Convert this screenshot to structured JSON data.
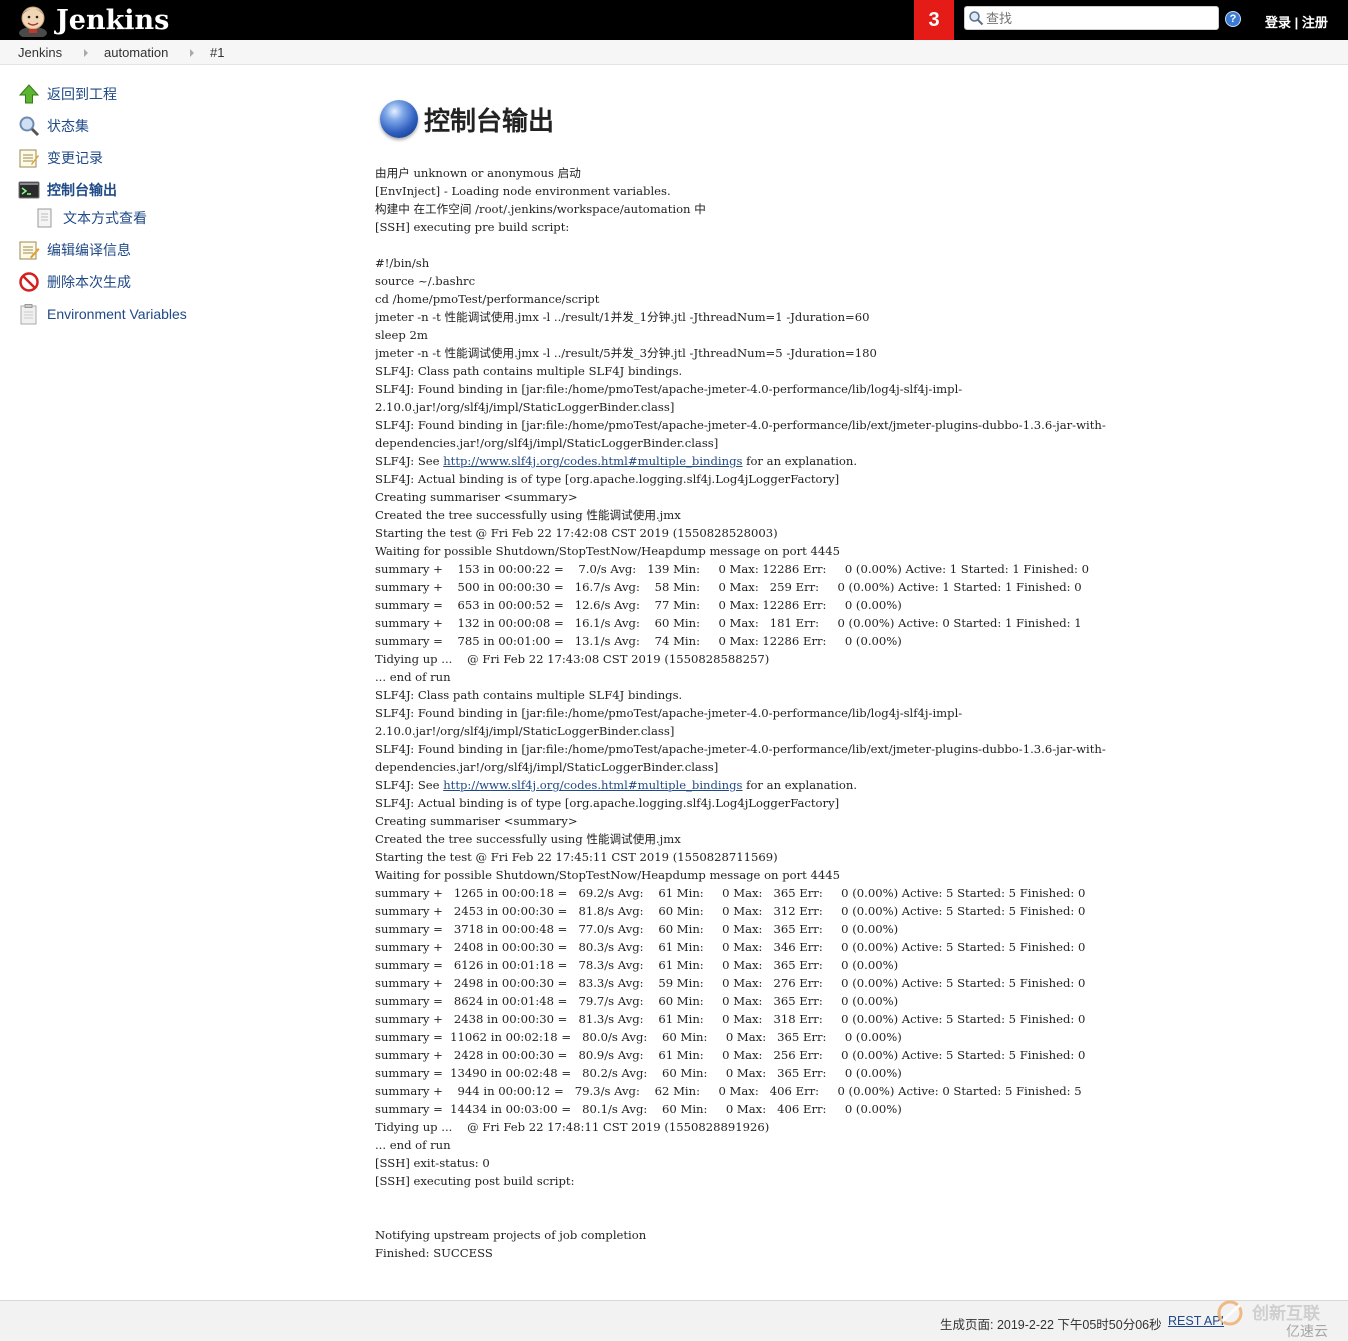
{
  "header": {
    "title": "Jenkins",
    "notification_count": "3",
    "search_placeholder": "查找",
    "help": "?",
    "login": "登录",
    "separator": "|",
    "signup": "注册"
  },
  "breadcrumb": [
    "Jenkins",
    "automation",
    "#1"
  ],
  "sidebar": {
    "items": [
      {
        "label": "返回到工程",
        "icon": "up-arrow-icon"
      },
      {
        "label": "状态集",
        "icon": "magnifier-icon"
      },
      {
        "label": "变更记录",
        "icon": "notepad-icon"
      },
      {
        "label": "控制台输出",
        "icon": "terminal-icon"
      },
      {
        "label": "文本方式查看",
        "icon": "document-icon"
      },
      {
        "label": "编辑编译信息",
        "icon": "notepad-edit-icon"
      },
      {
        "label": "删除本次生成",
        "icon": "no-entry-icon"
      },
      {
        "label": "Environment Variables",
        "icon": "clipboard-icon"
      }
    ]
  },
  "main": {
    "title": "控制台输出",
    "console_lines": [
      "由用户 unknown or anonymous 启动",
      "[EnvInject] - Loading node environment variables.",
      "构建中 在工作空间 /root/.jenkins/workspace/automation 中",
      "[SSH] executing pre build script:",
      "",
      "#!/bin/sh",
      "source ~/.bashrc",
      "cd /home/pmoTest/performance/script",
      "jmeter -n -t 性能调试使用.jmx -l ../result/1并发_1分钟.jtl -JthreadNum=1 -Jduration=60",
      "sleep 2m",
      "jmeter -n -t 性能调试使用.jmx -l ../result/5并发_3分钟.jtl -JthreadNum=5 -Jduration=180",
      "SLF4J: Class path contains multiple SLF4J bindings.",
      "SLF4J: Found binding in [jar:file:/home/pmoTest/apache-jmeter-4.0-performance/lib/log4j-slf4j-impl-",
      "2.10.0.jar!/org/slf4j/impl/StaticLoggerBinder.class]",
      "SLF4J: Found binding in [jar:file:/home/pmoTest/apache-jmeter-4.0-performance/lib/ext/jmeter-plugins-dubbo-1.3.6-jar-with-",
      "dependencies.jar!/org/slf4j/impl/StaticLoggerBinder.class]",
      "SLF4J: See http://www.slf4j.org/codes.html#multiple_bindings for an explanation.",
      "SLF4J: Actual binding is of type [org.apache.logging.slf4j.Log4jLoggerFactory]",
      "Creating summariser <summary>",
      "Created the tree successfully using 性能调试使用.jmx",
      "Starting the test @ Fri Feb 22 17:42:08 CST 2019 (1550828528003)",
      "Waiting for possible Shutdown/StopTestNow/Heapdump message on port 4445",
      "summary +    153 in 00:00:22 =    7.0/s Avg:   139 Min:     0 Max: 12286 Err:     0 (0.00%) Active: 1 Started: 1 Finished: 0",
      "summary +    500 in 00:00:30 =   16.7/s Avg:    58 Min:     0 Max:   259 Err:     0 (0.00%) Active: 1 Started: 1 Finished: 0",
      "summary =    653 in 00:00:52 =   12.6/s Avg:    77 Min:     0 Max: 12286 Err:     0 (0.00%)",
      "summary +    132 in 00:00:08 =   16.1/s Avg:    60 Min:     0 Max:   181 Err:     0 (0.00%) Active: 0 Started: 1 Finished: 1",
      "summary =    785 in 00:01:00 =   13.1/s Avg:    74 Min:     0 Max: 12286 Err:     0 (0.00%)",
      "Tidying up ...    @ Fri Feb 22 17:43:08 CST 2019 (1550828588257)",
      "... end of run",
      "SLF4J: Class path contains multiple SLF4J bindings.",
      "SLF4J: Found binding in [jar:file:/home/pmoTest/apache-jmeter-4.0-performance/lib/log4j-slf4j-impl-",
      "2.10.0.jar!/org/slf4j/impl/StaticLoggerBinder.class]",
      "SLF4J: Found binding in [jar:file:/home/pmoTest/apache-jmeter-4.0-performance/lib/ext/jmeter-plugins-dubbo-1.3.6-jar-with-",
      "dependencies.jar!/org/slf4j/impl/StaticLoggerBinder.class]",
      "SLF4J: See http://www.slf4j.org/codes.html#multiple_bindings for an explanation.",
      "SLF4J: Actual binding is of type [org.apache.logging.slf4j.Log4jLoggerFactory]",
      "Creating summariser <summary>",
      "Created the tree successfully using 性能调试使用.jmx",
      "Starting the test @ Fri Feb 22 17:45:11 CST 2019 (1550828711569)",
      "Waiting for possible Shutdown/StopTestNow/Heapdump message on port 4445",
      "summary +   1265 in 00:00:18 =   69.2/s Avg:    61 Min:     0 Max:   365 Err:     0 (0.00%) Active: 5 Started: 5 Finished: 0",
      "summary +   2453 in 00:00:30 =   81.8/s Avg:    60 Min:     0 Max:   312 Err:     0 (0.00%) Active: 5 Started: 5 Finished: 0",
      "summary =   3718 in 00:00:48 =   77.0/s Avg:    60 Min:     0 Max:   365 Err:     0 (0.00%)",
      "summary +   2408 in 00:00:30 =   80.3/s Avg:    61 Min:     0 Max:   346 Err:     0 (0.00%) Active: 5 Started: 5 Finished: 0",
      "summary =   6126 in 00:01:18 =   78.3/s Avg:    61 Min:     0 Max:   365 Err:     0 (0.00%)",
      "summary +   2498 in 00:00:30 =   83.3/s Avg:    59 Min:     0 Max:   276 Err:     0 (0.00%) Active: 5 Started: 5 Finished: 0",
      "summary =   8624 in 00:01:48 =   79.7/s Avg:    60 Min:     0 Max:   365 Err:     0 (0.00%)",
      "summary +   2438 in 00:00:30 =   81.3/s Avg:    61 Min:     0 Max:   318 Err:     0 (0.00%) Active: 5 Started: 5 Finished: 0",
      "summary =  11062 in 00:02:18 =   80.0/s Avg:    60 Min:     0 Max:   365 Err:     0 (0.00%)",
      "summary +   2428 in 00:00:30 =   80.9/s Avg:    61 Min:     0 Max:   256 Err:     0 (0.00%) Active: 5 Started: 5 Finished: 0",
      "summary =  13490 in 00:02:48 =   80.2/s Avg:    60 Min:     0 Max:   365 Err:     0 (0.00%)",
      "summary +    944 in 00:00:12 =   79.3/s Avg:    62 Min:     0 Max:   406 Err:     0 (0.00%) Active: 0 Started: 5 Finished: 5",
      "summary =  14434 in 00:03:00 =   80.1/s Avg:    60 Min:     0 Max:   406 Err:     0 (0.00%)",
      "Tidying up ...    @ Fri Feb 22 17:48:11 CST 2019 (1550828891926)",
      "... end of run",
      "[SSH] exit-status: 0",
      "[SSH] executing post build script:",
      "",
      "",
      "Notifying upstream projects of job completion",
      "Finished: SUCCESS"
    ],
    "link_text": "http://www.slf4j.org/codes.html#multiple_bindings"
  },
  "footer": {
    "generated": "生成页面: 2019-2-22 下午05时50分06秒",
    "rest_api": "REST API"
  },
  "watermark": {
    "line1": "创新互联",
    "line2": "亿速云"
  },
  "colors": {
    "header_bg": "#000000",
    "notification_bg": "#e41b17",
    "link": "#204a87"
  }
}
